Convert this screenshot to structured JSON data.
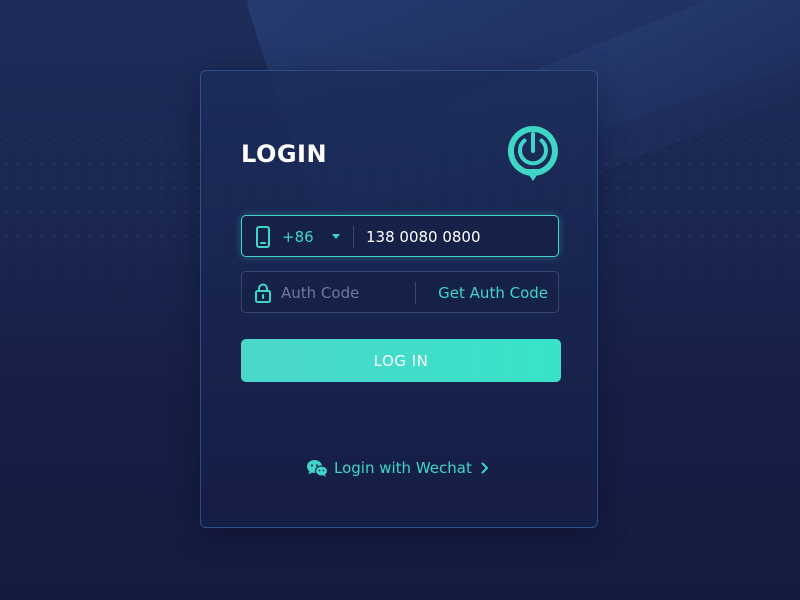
{
  "login": {
    "title": "LOGIN",
    "logo_icon": "power-pin-logo",
    "phone": {
      "icon": "smartphone-icon",
      "country_code": "+86",
      "dropdown_icon": "caret-down-icon",
      "value": "138 0080 0800"
    },
    "auth_code": {
      "icon": "lock-icon",
      "placeholder": "Auth Code",
      "get_code_label": "Get Auth Code"
    },
    "submit_label": "LOG IN",
    "wechat": {
      "icon": "wechat-icon",
      "label": "Login with Wechat",
      "arrow_icon": "chevron-right-icon"
    }
  },
  "colors": {
    "accent": "#3fd6c8",
    "button_start": "#4bd7cb",
    "button_end": "#38e3c8",
    "background": "#1a2752",
    "placeholder": "#6b7aa3"
  }
}
